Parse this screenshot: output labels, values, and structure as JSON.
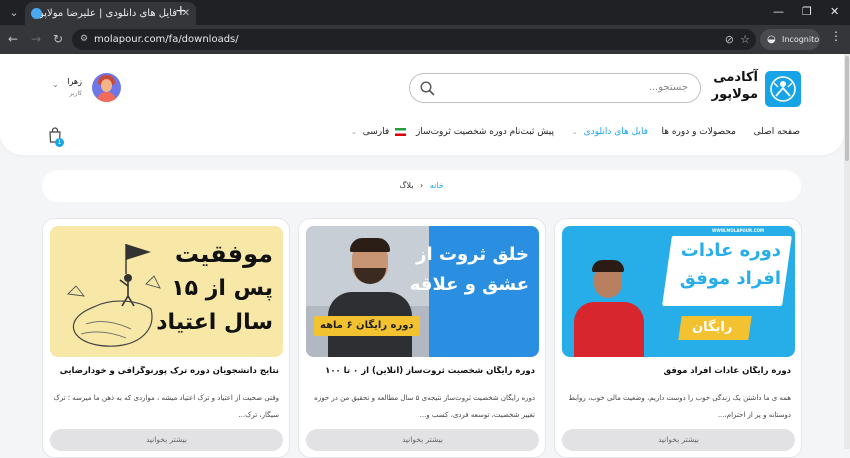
{
  "browser": {
    "tab_title": "فایل های دانلودی | علیرضا مولاپور",
    "new_tab": "+",
    "url": "molapour.com/fa/downloads/",
    "incognito_label": "Incognito"
  },
  "header": {
    "logo_line1": "آکادمی",
    "logo_line2": "مولاپور",
    "search_placeholder": "جستجو...",
    "user_name": "زهرا",
    "user_role": "کاربر",
    "cart_count": "1",
    "nav": {
      "home": "صفحه اصلی",
      "products": "محصولات و دوره ها",
      "downloads": "فایل های دانلودی",
      "preregister": "پیش ثبت‌نام دوره شخصیت ثروت‌ساز",
      "language": "فارسی"
    }
  },
  "breadcrumb": {
    "home": "خانه",
    "current": "بلاگ"
  },
  "cards": [
    {
      "title": "دوره رایگان عادات افراد موفق",
      "excerpt": "همه ی ما داشتن یک زندگی خوب را دوست داریم، وضعیت مالی خوب، روابط دوستانه و پر از احترام،...",
      "more": "بیشتر بخوانید",
      "img_line1": "دوره عادات",
      "img_line2": "افراد موفق",
      "img_badge": "رایگان",
      "img_site": "WWW.MOLAPOUR.COM"
    },
    {
      "title": "دوره رایگان شخصیت ثروت‌ساز (آنلاین) از ۰ تا ۱۰۰",
      "excerpt": "دوره رایگان شخصیت ثروت‌ساز نتیجه‌ی ۵ سال مطالعه و تحقیق من در حوزه تغییر شخصیت، توسعه فردی، کسب و...",
      "more": "بیشتر بخوانید",
      "img_line1": "خلق ثروت از",
      "img_line2": "عشق و علاقه",
      "img_badge": "دوره رایگان ۶ ماهه"
    },
    {
      "title": "نتایج دانشجویان دوره ترک پورنوگرافی و خودارضایی",
      "excerpt": "وقتی صحبت از اعتیاد و ترک اعتیاد میشه ، مواردی که به ذهن ما میرسه ؛ ترک سیگار، ترک...",
      "more": "بیشتر بخوانید",
      "img_line1": "موفقیت",
      "img_line2": "پس از ۱۵",
      "img_line3": "سال اعتیاد"
    }
  ]
}
